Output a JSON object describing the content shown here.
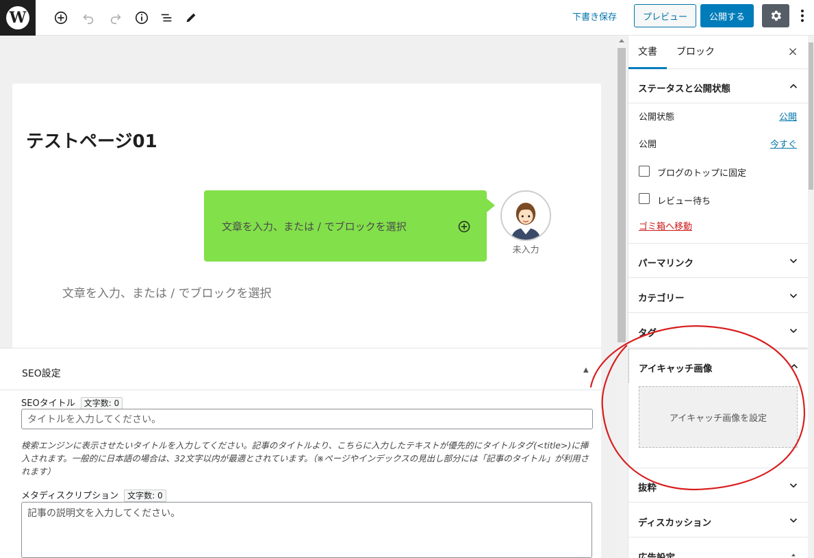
{
  "toolbar": {
    "logo_letter": "W",
    "add_block_icon": "plus-circle-icon",
    "undo_icon": "undo-icon",
    "redo_icon": "redo-icon",
    "info_icon": "info-icon",
    "outline_icon": "list-icon",
    "tools_icon": "pencil-icon",
    "save_draft": "下書き保存",
    "preview": "プレビュー",
    "publish": "公開する",
    "settings_icon": "gear-icon",
    "more_icon": "kebab-icon"
  },
  "editor": {
    "post_title": "テストページ01",
    "balloon_placeholder": "文章を入力、または / でブロックを選択",
    "avatar_name": "未入力",
    "paragraph_placeholder": "文章を入力、または / でブロックを選択",
    "balloon_color": "#82e04a"
  },
  "seo": {
    "heading": "SEO設定",
    "toggle": "▲",
    "title_label": "SEOタイトル",
    "title_count": "文字数: 0",
    "title_placeholder": "タイトルを入力してください。",
    "help_text": "検索エンジンに表示させたいタイトルを入力してください。記事のタイトルより、こちらに入力したテキストが優先的にタイトルタグ(<title>)に挿入されます。一般的に日本語の場合は、32文字以内が最適とされています。（※ページやインデックスの見出し部分には「記事のタイトル」が利用されます）",
    "desc_label": "メタディスクリプション",
    "desc_count": "文字数: 0",
    "desc_placeholder": "記事の説明文を入力してください。"
  },
  "sidebar": {
    "tab_document": "文書",
    "tab_block": "ブロック",
    "close": "×",
    "status_heading": "ステータスと公開状態",
    "visibility_label": "公開状態",
    "visibility_value": "公開",
    "publish_label": "公開",
    "publish_value": "今すぐ",
    "sticky_label": "ブログのトップに固定",
    "pending_label": "レビュー待ち",
    "trash_link": "ゴミ箱へ移動",
    "permalink": "パーマリンク",
    "categories": "カテゴリー",
    "tags": "タグ",
    "featured_image": "アイキャッチ画像",
    "set_featured_image": "アイキャッチ画像を設定",
    "excerpt": "抜粋",
    "discussion": "ディスカッション",
    "ad_settings": "広告設定"
  },
  "colors": {
    "accent": "#007cba",
    "annotation": "#d81e1e"
  }
}
